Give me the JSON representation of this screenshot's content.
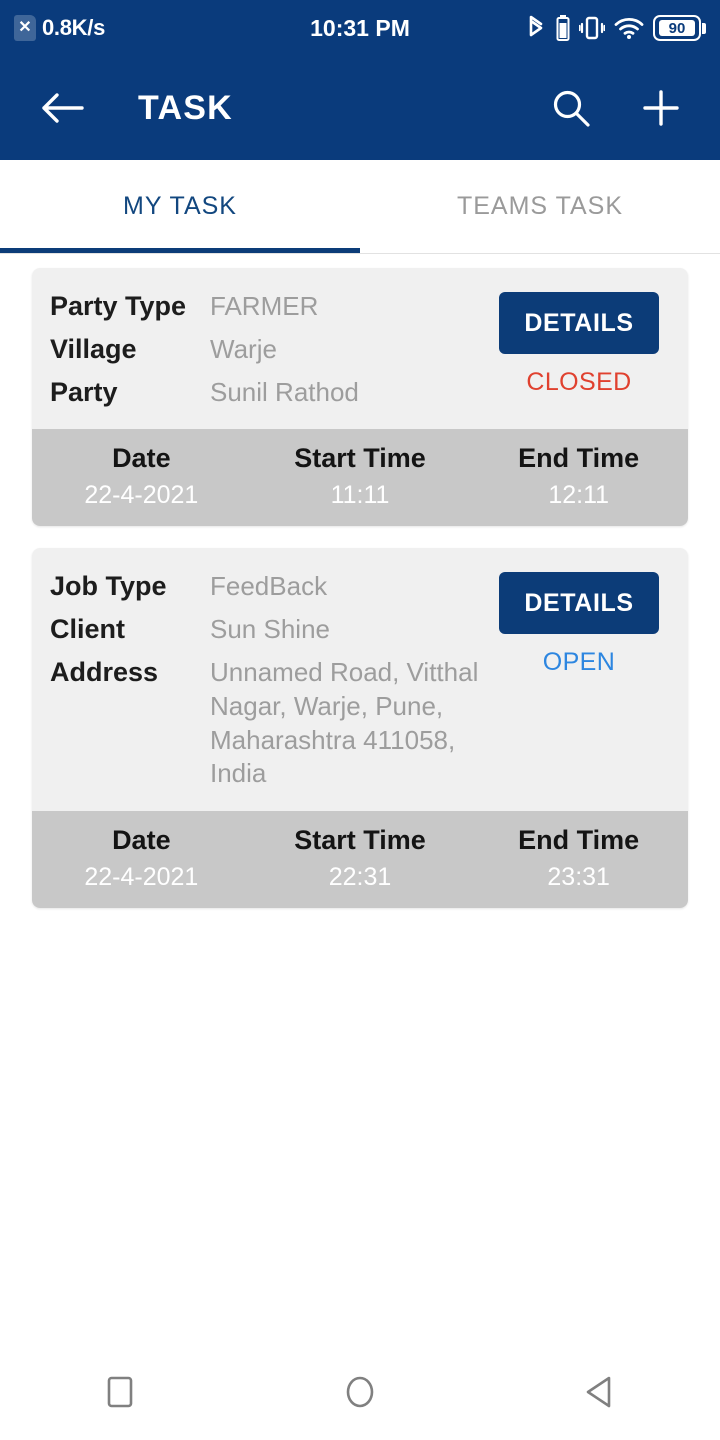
{
  "status_bar": {
    "sim_icon": "sim-card-x-icon",
    "network_speed": "0.8K/s",
    "clock": "10:31 PM",
    "icons": [
      "bluetooth-icon",
      "battery-small-icon",
      "vibrate-icon",
      "wifi-icon"
    ],
    "battery_level": "90"
  },
  "app_bar": {
    "back_icon": "arrow-left-icon",
    "title": "TASK",
    "search_icon": "search-icon",
    "add_icon": "plus-icon"
  },
  "tabs": [
    {
      "label": "MY TASK",
      "active": true
    },
    {
      "label": "TEAMS TASK",
      "active": false
    }
  ],
  "colors": {
    "primary": "#0a3b7c",
    "button": "#0c3c78",
    "closed": "#e0412f",
    "open": "#2d86e0",
    "card_top": "#f0f0f0",
    "card_bottom": "#c8c8c8"
  },
  "task_cards": [
    {
      "fields": [
        {
          "label": "Party Type",
          "value": "FARMER"
        },
        {
          "label": "Village",
          "value": "Warje"
        },
        {
          "label": "Party",
          "value": "Sunil Rathod"
        }
      ],
      "details_label": "DETAILS",
      "status": "CLOSED",
      "status_color": "#e0412f",
      "schedule": {
        "date_header": "Date",
        "start_header": "Start Time",
        "end_header": "End Time",
        "date": "22-4-2021",
        "start": "11:11",
        "end": "12:11"
      }
    },
    {
      "fields": [
        {
          "label": "Job Type",
          "value": "FeedBack"
        },
        {
          "label": "Client",
          "value": "Sun Shine"
        },
        {
          "label": "Address",
          "value": "Unnamed Road, Vitthal Nagar, Warje, Pune, Maharashtra 411058, India"
        }
      ],
      "details_label": "DETAILS",
      "status": "OPEN",
      "status_color": "#2d86e0",
      "schedule": {
        "date_header": "Date",
        "start_header": "Start Time",
        "end_header": "End Time",
        "date": "22-4-2021",
        "start": "22:31",
        "end": "23:31"
      }
    }
  ],
  "nav_bar": {
    "recents_icon": "square-icon",
    "home_icon": "circle-icon",
    "back_icon": "triangle-left-icon"
  }
}
